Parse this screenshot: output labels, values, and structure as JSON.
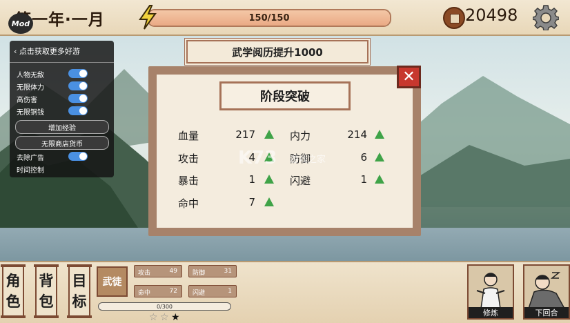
{
  "header": {
    "date": "第一年·一月",
    "mod_badge": "Mod",
    "energy": {
      "text": "150/150",
      "fill_fraction": 1.0
    },
    "coins": "20498"
  },
  "cheat_menu": {
    "title": "点击获取更多好游",
    "toggles": [
      {
        "label": "人物无敌",
        "on": true
      },
      {
        "label": "无限体力",
        "on": true
      },
      {
        "label": "高伤害",
        "on": true
      },
      {
        "label": "无限铜钱",
        "on": true
      }
    ],
    "buttons": [
      "增加经验",
      "无限商店货币"
    ],
    "ad_toggle": {
      "label": "去除广告",
      "on": true
    },
    "time_control": "时间控制"
  },
  "banner": "武学阅历提升1000",
  "dialog": {
    "title": "阶段突破",
    "close_icon": "✕",
    "stats": [
      {
        "name": "血量",
        "value": "217"
      },
      {
        "name": "内力",
        "value": "214"
      },
      {
        "name": "攻击",
        "value": "4"
      },
      {
        "name": "防御",
        "value": "6"
      },
      {
        "name": "暴击",
        "value": "1"
      },
      {
        "name": "闪避",
        "value": "1"
      },
      {
        "name": "命中",
        "value": "7"
      }
    ]
  },
  "watermark": {
    "main": "K73",
    "sub": "游戏之家"
  },
  "bottom": {
    "menu": [
      {
        "top": "角",
        "bottom": "色"
      },
      {
        "top": "背",
        "bottom": "包"
      },
      {
        "top": "目",
        "bottom": "标"
      }
    ],
    "rank": "武徒",
    "mini_stats": [
      {
        "label": "攻击",
        "value": "49"
      },
      {
        "label": "防御",
        "value": "31"
      },
      {
        "label": "命中",
        "value": "72"
      },
      {
        "label": "闪避",
        "value": "1"
      }
    ],
    "xp": "0/300",
    "stars": {
      "filled": 1,
      "total": 3
    },
    "actions": [
      "修炼",
      "下回合"
    ]
  },
  "colors": {
    "accent_green": "#3fa348",
    "close_red": "#c7382e",
    "frame_brown": "#a67258",
    "toggle_blue": "#4a90e2"
  }
}
